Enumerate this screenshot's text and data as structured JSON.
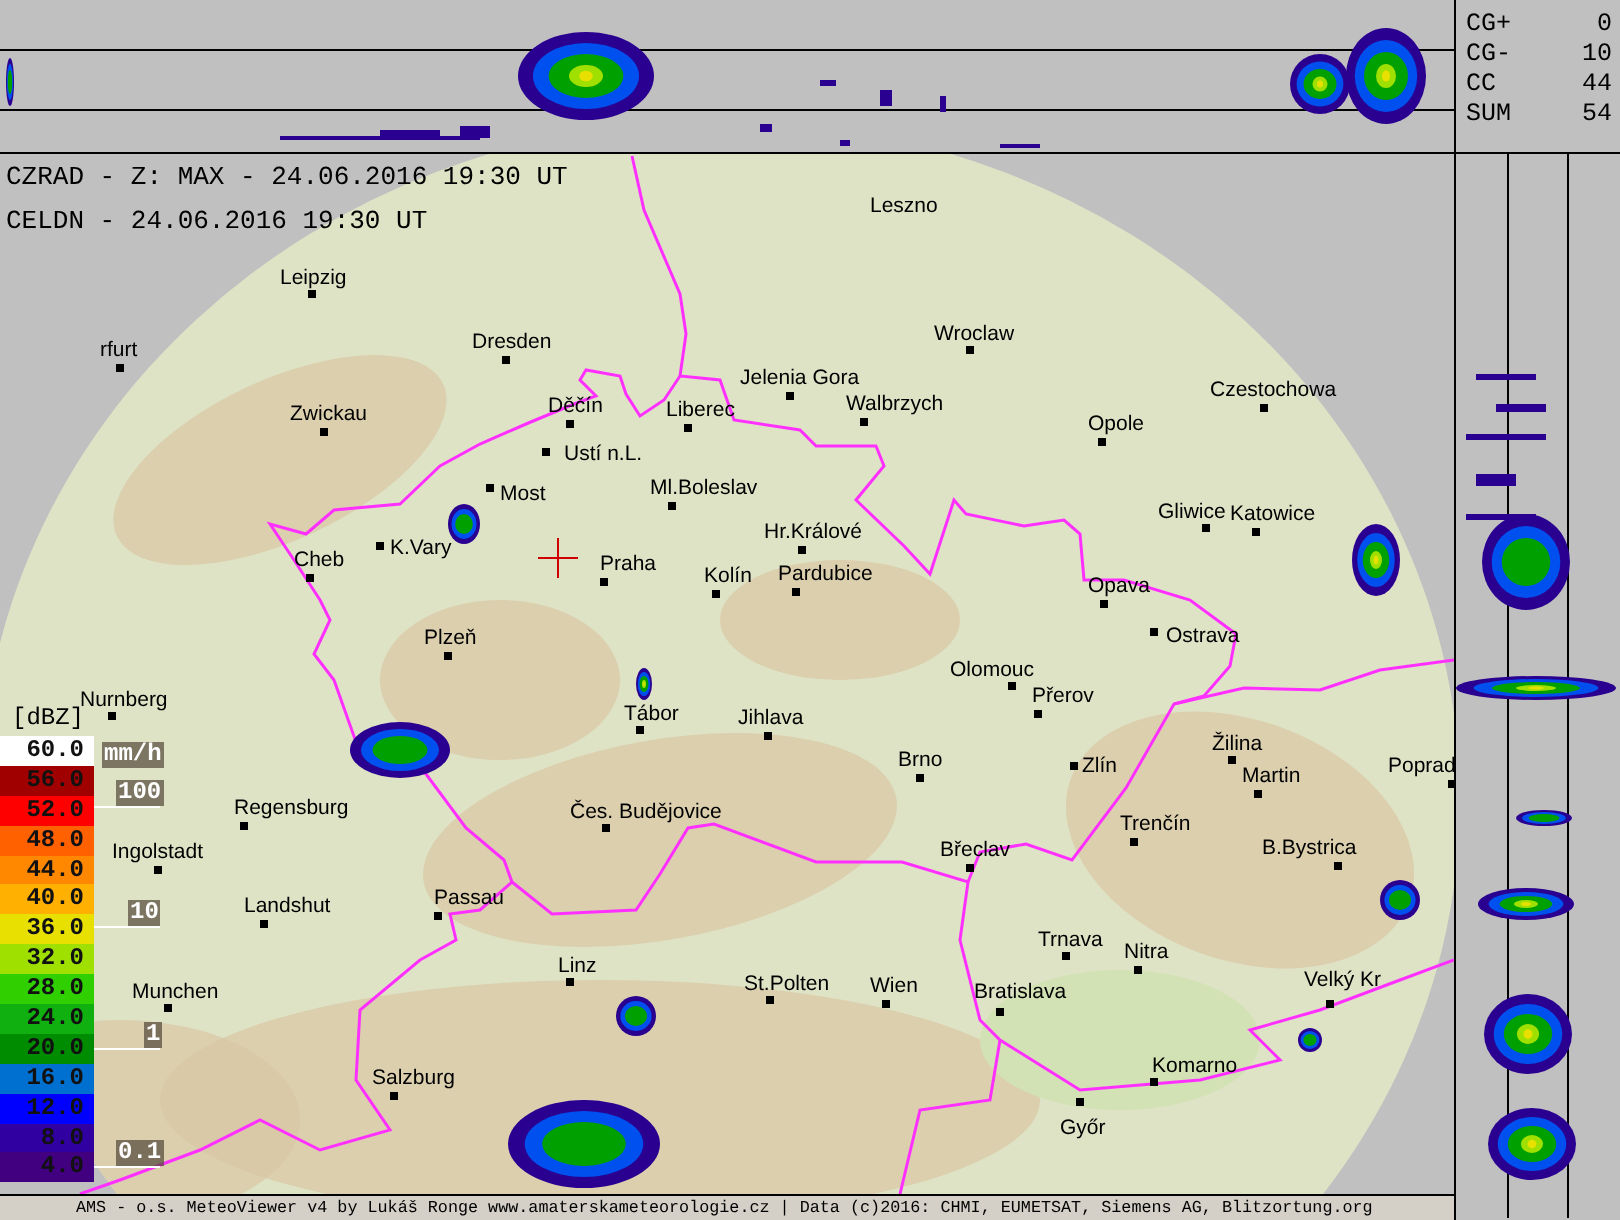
{
  "header": {
    "radar_title": "CZRAD - Z: MAX - 24.06.2016 19:30 UT",
    "lightning_title": "CELDN - 24.06.2016 19:30 UT"
  },
  "lightning_counts": [
    {
      "label": "CG+",
      "value": "0"
    },
    {
      "label": "CG-",
      "value": "10"
    },
    {
      "label": "CC",
      "value": "44"
    },
    {
      "label": "SUM",
      "value": "54"
    }
  ],
  "legend": {
    "unit": "[dBZ]",
    "rain_unit": "mm/h",
    "rain_marks": [
      "100",
      "10",
      "1",
      "0.1"
    ],
    "levels": [
      {
        "label": "60.0",
        "color": "#ffffff"
      },
      {
        "label": "56.0",
        "color": "#a00000"
      },
      {
        "label": "52.0",
        "color": "#ff0000"
      },
      {
        "label": "48.0",
        "color": "#ff6000"
      },
      {
        "label": "44.0",
        "color": "#ff8800"
      },
      {
        "label": "40.0",
        "color": "#ffb000"
      },
      {
        "label": "36.0",
        "color": "#e8e000"
      },
      {
        "label": "32.0",
        "color": "#a0e000"
      },
      {
        "label": "28.0",
        "color": "#30d000"
      },
      {
        "label": "24.0",
        "color": "#10b010"
      },
      {
        "label": "20.0",
        "color": "#008c00"
      },
      {
        "label": "16.0",
        "color": "#0070d0"
      },
      {
        "label": "12.0",
        "color": "#0000ff"
      },
      {
        "label": "8.0",
        "color": "#3000a0"
      },
      {
        "label": "4.0",
        "color": "#400080"
      }
    ]
  },
  "cities": [
    {
      "name": "Leszno"
    },
    {
      "name": "Leipzig"
    },
    {
      "name": "Dresden"
    },
    {
      "name": "Wroclaw"
    },
    {
      "name": "rfurt"
    },
    {
      "name": "Jelenia Gora"
    },
    {
      "name": "Walbrzych"
    },
    {
      "name": "Czestochowa"
    },
    {
      "name": "Zwickau"
    },
    {
      "name": "Děčín"
    },
    {
      "name": "Liberec"
    },
    {
      "name": "Opole"
    },
    {
      "name": "Ustí n.L."
    },
    {
      "name": "Most"
    },
    {
      "name": "Ml.Boleslav"
    },
    {
      "name": "Gliwice"
    },
    {
      "name": "Katowice"
    },
    {
      "name": "Hr.Králové"
    },
    {
      "name": "K.Vary"
    },
    {
      "name": "Cheb"
    },
    {
      "name": "Praha"
    },
    {
      "name": "Kolín"
    },
    {
      "name": "Pardubice"
    },
    {
      "name": "Opava"
    },
    {
      "name": "Ostrava"
    },
    {
      "name": "Plzeň"
    },
    {
      "name": "Olomouc"
    },
    {
      "name": "Přerov"
    },
    {
      "name": "Tábor"
    },
    {
      "name": "Jihlava"
    },
    {
      "name": "Žilina"
    },
    {
      "name": "Brno"
    },
    {
      "name": "Zlín"
    },
    {
      "name": "Martin"
    },
    {
      "name": "Poprad"
    },
    {
      "name": "Nurnberg"
    },
    {
      "name": "Regensburg"
    },
    {
      "name": "Čes. Budějovice"
    },
    {
      "name": "Trenčín"
    },
    {
      "name": "Ingolstadt"
    },
    {
      "name": "Břeclav"
    },
    {
      "name": "B.Bystrica"
    },
    {
      "name": "Landshut"
    },
    {
      "name": "Passau"
    },
    {
      "name": "Trnava"
    },
    {
      "name": "Nitra"
    },
    {
      "name": "Linz"
    },
    {
      "name": "Munchen"
    },
    {
      "name": "St.Polten"
    },
    {
      "name": "Wien"
    },
    {
      "name": "Bratislava"
    },
    {
      "name": "Velký Kr"
    },
    {
      "name": "Komarno"
    },
    {
      "name": "Salzburg"
    },
    {
      "name": "Győr"
    }
  ],
  "footer": "AMS - o.s. MeteoViewer v4 by Lukáš Ronge www.amaterskameteorologie.cz | Data (c)2016: CHMI, EUMETSAT, Siemens AG, Blitzortung.org"
}
